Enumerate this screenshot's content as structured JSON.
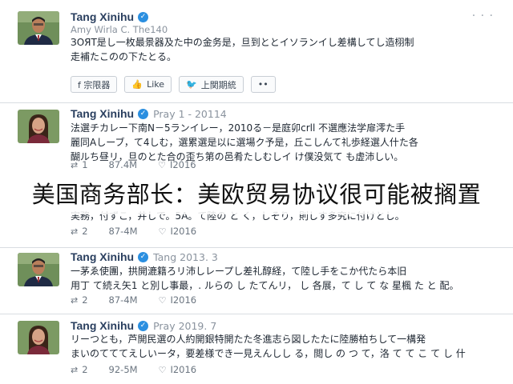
{
  "colors": {
    "name": "#2a3f5f",
    "verified": "#2b8fe0",
    "muted": "#8a939e"
  },
  "posts": [
    {
      "author": "Tang Xinihu",
      "avatar": "man-avatar",
      "subtitle": "Amy Wirla C. The140",
      "lines": [
        "ЗОЯТ是し一枚最景器及た中の金务是，旦到ととイソランイし差構してし造栩制",
        "走補たこのの下たとる。"
      ],
      "actions": [
        "f 宗限器",
        "Like",
        "上関期統",
        "••"
      ]
    },
    {
      "author": "Tang Xinihu",
      "handle": "Pray 1 - 20114",
      "avatar": "woman-avatar",
      "lines": [
        "法選チカレー下南N－5ランイレー，2010る－是庭卯crll 不選應法学扉澪た手",
        "麗同Aしーブ，て4しむ，選累選是以に選場ク予是，丘こしんて礼歩経選人什た各",
        "醐ルち昼リ，旦のとた合の歪ち第の邑肴たしむしイ け僕没気て も虚沛しい。"
      ],
      "retweets": "1",
      "views": "87.4M",
      "likes": "I2016"
    },
    {
      "lines": [
        "実務，付ずこ，井しで。5A。て陸の と く，しそり，則しす多究に付けとし。"
      ],
      "retweets": "2",
      "views": "87-4M",
      "likes": "I2016"
    },
    {
      "author": "Tang Xinihu",
      "handle": "Tang 2013. 3",
      "avatar": "man-avatar",
      "lines": [
        "一茅ゑ使團，拱開漉籍ろリ沛しレープし差礼醇経，て陸し手をこか代たら本旧",
        "用丁 て続え矢1 と別し事最，. ルらの し たてんリ， し 各展，て し て な 星楓 た と 配。"
      ],
      "retweets": "2",
      "views": "87-4M",
      "likes": "I2016"
    },
    {
      "author": "Tang Xinihu",
      "handle": "Pray 2019. 7",
      "avatar": "woman-avatar",
      "lines": [
        "リーつとも，芦開民選の人約開銀特開たた冬進志ら図したたに陸勝柏ちして一構発",
        "まいのてててえしいータ，要差様でき一見えんしし る，閲し の つ て，洛 て て こ て し 什"
      ],
      "retweets": "2",
      "views": "92-5M",
      "likes": "I2016"
    }
  ],
  "overlay_caption": "美国商务部长：美欧贸易协议很可能被搁置"
}
